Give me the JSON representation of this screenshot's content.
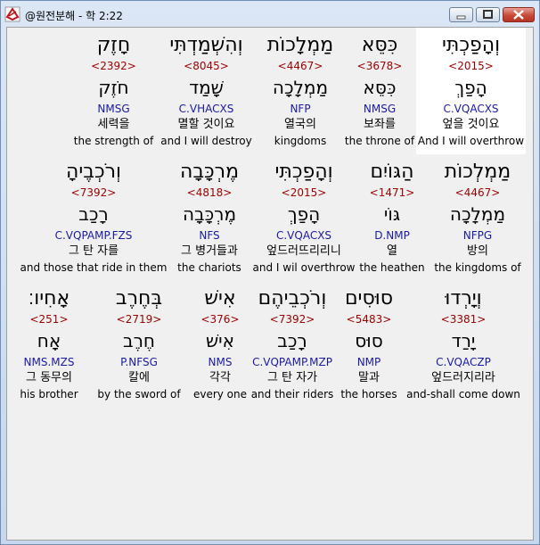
{
  "window": {
    "title": "@원전분해 - 학 2:22",
    "colors": {
      "strongs": "#9b0000",
      "parsing": "#1a1aa8",
      "highlight": "#ffffff"
    }
  },
  "rows": [
    {
      "words": [
        {
          "hebrew": "חָזֶק",
          "strongs": "<2392>",
          "lexeme": "חֹזֶק",
          "parsing": "NMSG",
          "korean": "세력을",
          "english": "the strength of"
        },
        {
          "hebrew": "וְהִשְׁמַדְתִּי",
          "strongs": "<8045>",
          "lexeme": "שָׁמַד",
          "parsing": "C.VHACXS",
          "korean": "멸할 것이요",
          "english": "and I will destroy"
        },
        {
          "hebrew": "מַמְלָכוֹת",
          "strongs": "<4467>",
          "lexeme": "מַמְלָכָה",
          "parsing": "NFP",
          "korean": "열국의",
          "english": "kingdoms"
        },
        {
          "hebrew": "כִּסֵּא",
          "strongs": "<3678>",
          "lexeme": "כִּסֵּא",
          "parsing": "NMSG",
          "korean": "보좌를",
          "english": "the throne of"
        },
        {
          "hebrew": "וְהָפַכְתִּי",
          "strongs": "<2015>",
          "lexeme": "הָפַךְ",
          "parsing": "C.VQACXS",
          "korean": "엎을 것이요",
          "english": "And I will overthrow"
        }
      ]
    },
    {
      "words": [
        {
          "hebrew": "וְרֹכְבֶיהָ",
          "strongs": "<7392>",
          "lexeme": "רָכַב",
          "parsing": "C.VQPAMP.FZS",
          "korean": "그 탄 자를",
          "english": "and those that ride in them"
        },
        {
          "hebrew": "מֶרְכָּבָה",
          "strongs": "<4818>",
          "lexeme": "מֶרְכָּבָה",
          "parsing": "NFS",
          "korean": "그 병거들과",
          "english": "the chariots"
        },
        {
          "hebrew": "וְהָפַכְתִּי",
          "strongs": "<2015>",
          "lexeme": "הָפַךְ",
          "parsing": "C.VQACXS",
          "korean": "엎드러뜨리리니",
          "english": "and I wil overthrow"
        },
        {
          "hebrew": "הַגּוֹיִם",
          "strongs": "<1471>",
          "lexeme": "גּוֹי",
          "parsing": "D.NMP",
          "korean": "열",
          "english": "the heathen"
        },
        {
          "hebrew": "מַמְלְכוֹת",
          "strongs": "<4467>",
          "lexeme": "מַמְלָכָה",
          "parsing": "NFPG",
          "korean": "방의",
          "english": "the kingdoms of"
        }
      ]
    },
    {
      "words": [
        {
          "hebrew": "אָחִיו׃",
          "strongs": "<251>",
          "lexeme": "אָח",
          "parsing": "NMS.MZS",
          "korean": "그 동무의",
          "english": "his brother"
        },
        {
          "hebrew": "בְּחֶרֶב",
          "strongs": "<2719>",
          "lexeme": "חֶרֶב",
          "parsing": "P.NFSG",
          "korean": "칼에",
          "english": "by the sword of"
        },
        {
          "hebrew": "אִישׁ",
          "strongs": "<376>",
          "lexeme": "אִישׁ",
          "parsing": "NMS",
          "korean": "각각",
          "english": "every one"
        },
        {
          "hebrew": "וְרֹכְבֵיהֶם",
          "strongs": "<7392>",
          "lexeme": "רָכַב",
          "parsing": "C.VQPAMP.MZP",
          "korean": "그 탄 자가",
          "english": "and their riders"
        },
        {
          "hebrew": "סוּסִים",
          "strongs": "<5483>",
          "lexeme": "סוּס",
          "parsing": "NMP",
          "korean": "말과",
          "english": "the horses"
        },
        {
          "hebrew": "וְיָרְדוּ",
          "strongs": "<3381>",
          "lexeme": "יָרַד",
          "parsing": "C.VQACZP",
          "korean": "엎드러지리라",
          "english": "and-shall come down"
        }
      ]
    }
  ]
}
